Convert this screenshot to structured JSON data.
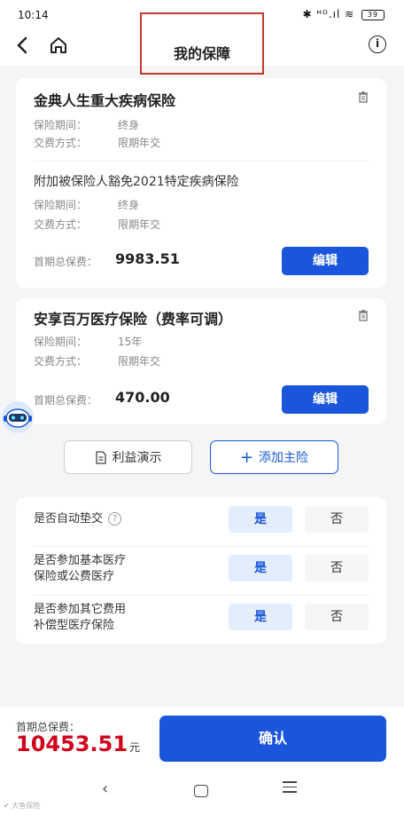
{
  "status_bar": {
    "time": "10:14",
    "signal": "✱ ᴴᴰ.ıl ≋",
    "battery": "39"
  },
  "nav": {
    "title": "我的保障",
    "info_glyph": "i"
  },
  "card1": {
    "product_name": "金典人生重大疾病保险",
    "product_rows": [
      {
        "label": "保险期间：",
        "value": "终身"
      },
      {
        "label": "交费方式：",
        "value": "限期年交"
      }
    ],
    "sub_product_name": "附加被保险人豁免2021特定疾病保险",
    "sub_product_rows": [
      {
        "label": "保险期间：",
        "value": "终身"
      },
      {
        "label": "交费方式：",
        "value": "限期年交"
      }
    ],
    "premium_label": "首期总保费：",
    "premium_value": "9983.51",
    "edit_label": "编辑"
  },
  "card2": {
    "product_name": "安享百万医疗保险（费率可调）",
    "product_rows": [
      {
        "label": "保险期间：",
        "value": "15年"
      },
      {
        "label": "交费方式：",
        "value": "限期年交"
      }
    ],
    "premium_label": "首期总保费：",
    "premium_value": "470.00",
    "edit_label": "编辑"
  },
  "actions": {
    "benefit_label": "利益演示",
    "add_label": "添加主险",
    "add_glyph": "+"
  },
  "options": [
    {
      "label": "是否自动垫交",
      "yes": "是",
      "no": "否",
      "selected": "yes",
      "help": "?"
    },
    {
      "label_line1": "是否参加基本医疗",
      "label_line2": "保险或公费医疗",
      "yes": "是",
      "no": "否",
      "selected": "yes"
    },
    {
      "label_line1": "是否参加其它费用",
      "label_line2": "补偿型医疗保险",
      "yes": "是",
      "no": "否",
      "selected": "yes"
    }
  ],
  "bottom": {
    "total_label": "首期总保费：",
    "total_value": "10453.51",
    "total_unit": "元",
    "confirm_label": "确认"
  },
  "sys_nav": {
    "back_glyph": "‹"
  },
  "watermark": "✔ 大鱼保险",
  "colors": {
    "primary": "#1a56db",
    "price_red": "#d0021b",
    "highlight_box": "#c0392b"
  }
}
